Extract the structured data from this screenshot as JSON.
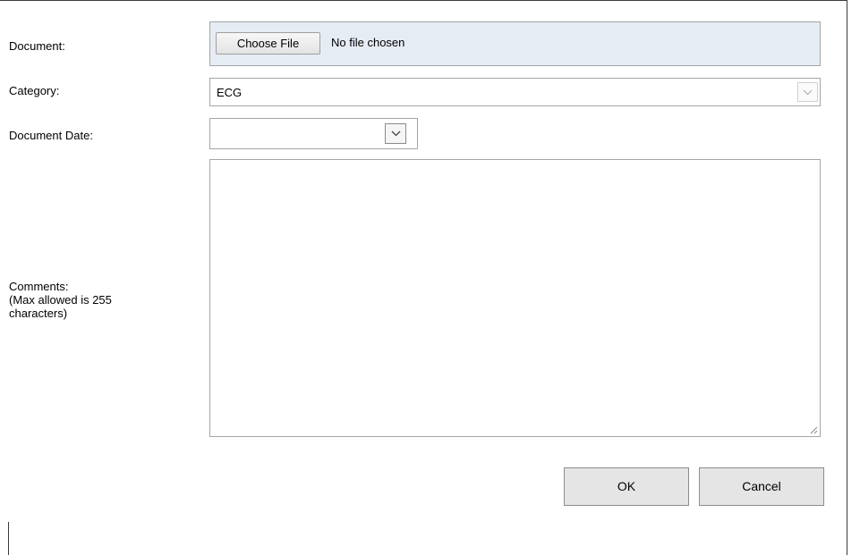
{
  "form": {
    "document": {
      "label": "Document:",
      "button_label": "Choose File",
      "status": "No file chosen"
    },
    "category": {
      "label": "Category:",
      "selected": "ECG"
    },
    "document_date": {
      "label": "Document Date:",
      "value": ""
    },
    "comments": {
      "label_line1": "Comments:",
      "label_line2": "(Max allowed is 255",
      "label_line3": "characters)",
      "value": ""
    }
  },
  "buttons": {
    "ok": "OK",
    "cancel": "Cancel"
  },
  "colors": {
    "file_box_bg": "#e6ecf3",
    "border": "#a5a5a5",
    "button_bg": "#e5e5e5"
  },
  "icons": {
    "dropdown": "chevron-down-icon",
    "resize": "resize-grip-icon"
  }
}
